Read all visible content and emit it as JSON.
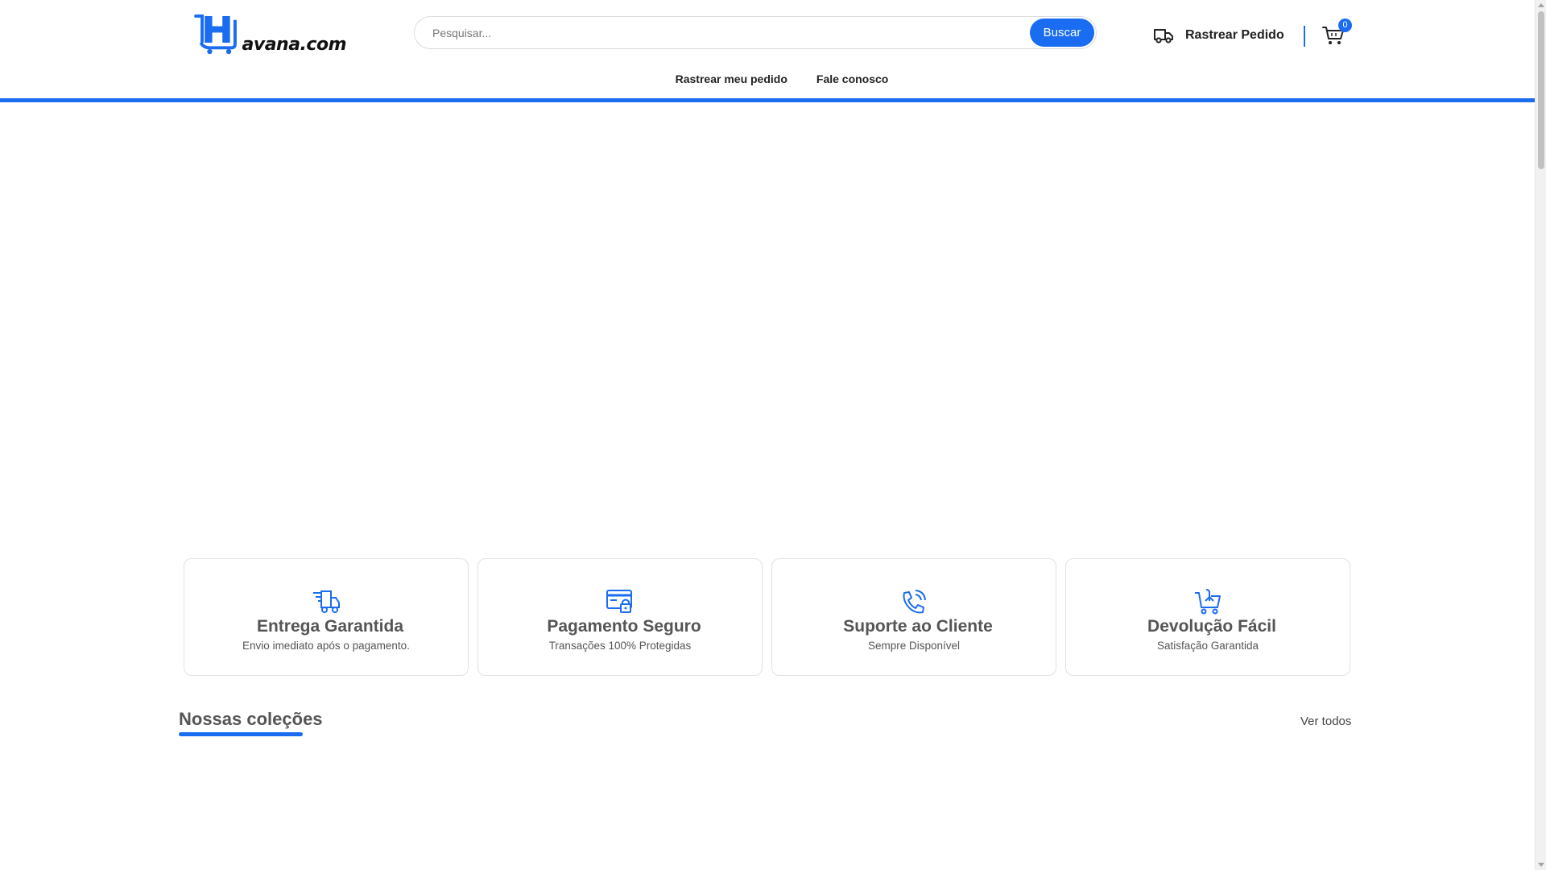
{
  "header": {
    "logo_text": "avana.com",
    "search": {
      "placeholder": "Pesquisar...",
      "button_label": "Buscar"
    },
    "track_order_label": "Rastrear Pedido",
    "cart_count": "0",
    "nav": [
      {
        "label": "Rastrear meu pedido"
      },
      {
        "label": "Fale conosco"
      }
    ]
  },
  "features": [
    {
      "icon": "delivery-truck-icon",
      "title": "Entrega Garantida",
      "description": "Envio imediato após o pagamento."
    },
    {
      "icon": "secure-payment-icon",
      "title": "Pagamento Seguro",
      "description": "Transações 100% Protegidas"
    },
    {
      "icon": "phone-support-icon",
      "title": "Suporte ao Cliente",
      "description": "Sempre Disponível"
    },
    {
      "icon": "cart-return-icon",
      "title": "Devolução Fácil",
      "description": "Satisfação Garantida"
    }
  ],
  "collections": {
    "title": "Nossas coleções",
    "see_all_label": "Ver todos"
  },
  "colors": {
    "accent": "#1a6cf0",
    "text": "#555555"
  }
}
